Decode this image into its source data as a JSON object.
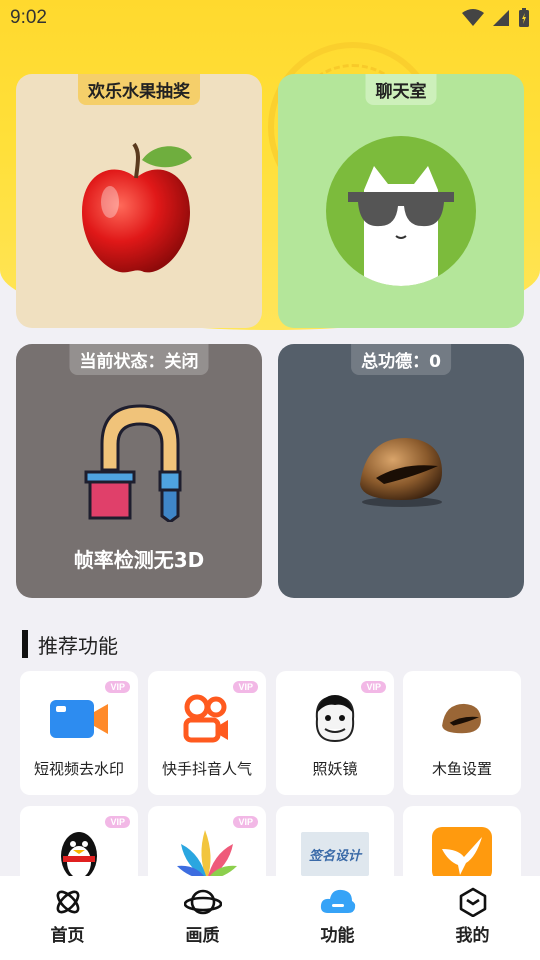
{
  "status_bar": {
    "time": "9:02"
  },
  "cards": {
    "fruit": {
      "tag": "欢乐水果抽奖"
    },
    "chat": {
      "tag": "聊天室"
    },
    "fps": {
      "tag": "当前状态：关闭",
      "caption": "帧率检测无3D"
    },
    "muyu": {
      "tag": "总功德：0"
    }
  },
  "section": {
    "title": "推荐功能"
  },
  "features": [
    {
      "label": "短视频去水印",
      "vip": "VIP",
      "icon": "video-camera-icon"
    },
    {
      "label": "快手抖音人气",
      "vip": "VIP",
      "icon": "kuaishou-icon"
    },
    {
      "label": "照妖镜",
      "vip": "VIP",
      "icon": "meme-face-icon"
    },
    {
      "label": "木鱼设置",
      "vip": "",
      "icon": "wooden-fish-icon"
    },
    {
      "label": "",
      "vip": "VIP",
      "icon": "qq-penguin-icon"
    },
    {
      "label": "",
      "vip": "VIP",
      "icon": "petal-icon"
    },
    {
      "label": "签名设计",
      "vip": "",
      "icon": "signature-icon"
    },
    {
      "label": "",
      "vip": "",
      "icon": "hummingbird-icon"
    }
  ],
  "nav": [
    {
      "label": "首页",
      "icon": "home-atom-icon"
    },
    {
      "label": "画质",
      "icon": "planet-icon"
    },
    {
      "label": "功能",
      "icon": "cloud-icon",
      "active": true
    },
    {
      "label": "我的",
      "icon": "cube-icon"
    }
  ],
  "colors": {
    "accent": "#ffd92e",
    "nav_active": "#36a3f7"
  }
}
